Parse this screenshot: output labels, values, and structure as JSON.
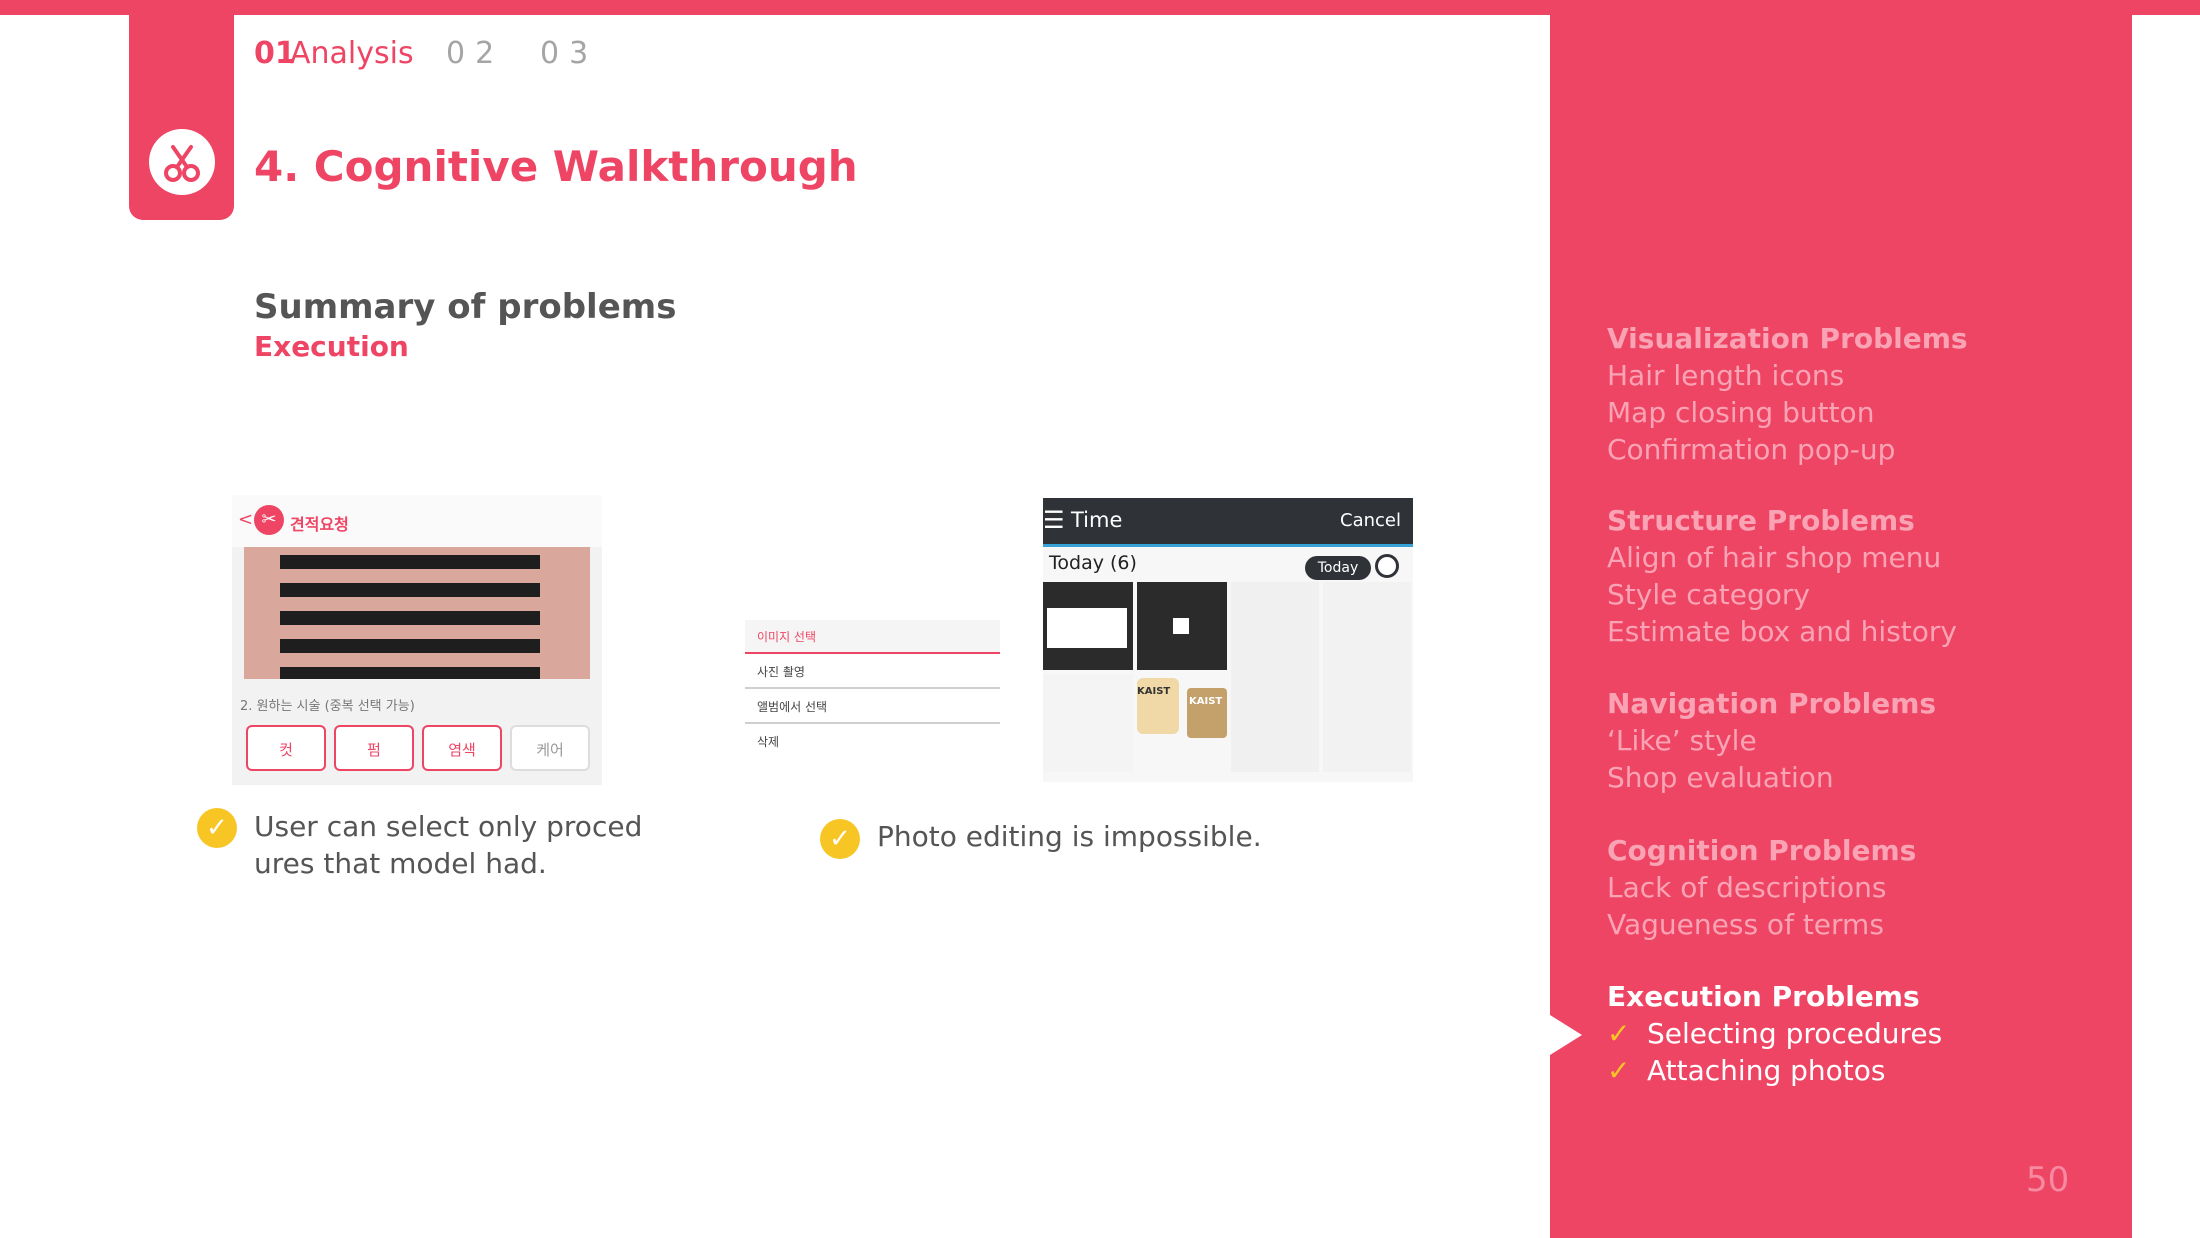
{
  "nav": {
    "n1": "01",
    "n1_label": "Analysis",
    "n2": "02",
    "n3": "03"
  },
  "section_title": "4. Cognitive Walkthrough",
  "summary": {
    "title": "Summary of problems",
    "subtitle": "Execution"
  },
  "shot1": {
    "back": "<",
    "title": "견적요청",
    "label": "2. 원하는 시술 (중복 선택 가능)",
    "options": [
      "컷",
      "펌",
      "염색",
      "케어"
    ]
  },
  "shot2": {
    "menu": [
      "이미지 선택",
      "사진 촬영",
      "앨범에서 선택",
      "삭제"
    ]
  },
  "shot3": {
    "title": "Time",
    "cancel": "Cancel",
    "today_label": "Today  (6)",
    "today_pill": "Today",
    "thumb_texts": [
      "KAIST",
      "KAIST"
    ]
  },
  "captions": {
    "c1": "User can select only proced ures that model had.",
    "c2": "Photo editing is impossible."
  },
  "side": {
    "groups": [
      {
        "title": "Visualization Problems",
        "items": [
          "Hair length icons",
          "Map closing button",
          "Confirmation pop-up"
        ]
      },
      {
        "title": "Structure Problems",
        "items": [
          "Align of hair shop menu",
          "Style category",
          "Estimate box and history"
        ]
      },
      {
        "title": "Navigation Problems",
        "items": [
          "‘Like’ style",
          "Shop evaluation"
        ]
      },
      {
        "title": "Cognition Problems",
        "items": [
          "Lack of descriptions",
          "Vagueness of terms"
        ]
      },
      {
        "title": "Execution Problems",
        "items": [
          "Selecting procedures",
          "Attaching photos"
        ]
      }
    ],
    "check_glyph": "✓"
  },
  "page_number": "50",
  "colors": {
    "accent": "#ef4565",
    "check": "#f7c625",
    "muted_text": "#555555"
  },
  "icons": [
    "scissors-icon",
    "check-circle-icon",
    "menu-icon",
    "back-chevron-icon"
  ]
}
